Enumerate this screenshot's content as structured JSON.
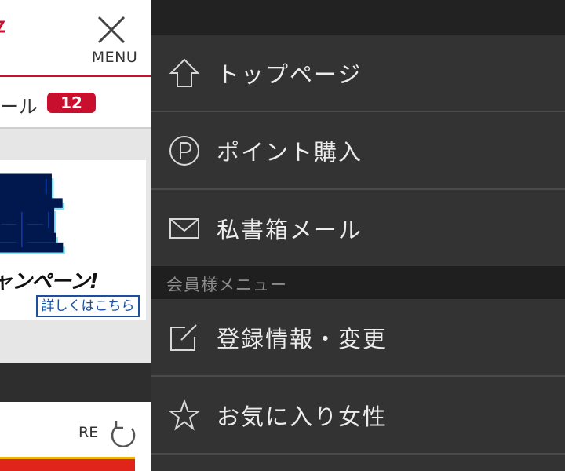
{
  "header": {
    "menu_label": "MENU"
  },
  "mail_row": {
    "label": "ール",
    "badge_count": "12"
  },
  "banner": {
    "big_char": "量",
    "subtitle": "ャンペーン!",
    "link_label": "詳しくはこちら"
  },
  "refresh": {
    "label": "RE"
  },
  "side_menu": {
    "items": [
      {
        "label": "トップページ",
        "icon": "home-icon"
      },
      {
        "label": "ポイント購入",
        "icon": "point-icon"
      },
      {
        "label": "私書箱メール",
        "icon": "mail-icon"
      }
    ],
    "section_label": "会員様メニュー",
    "member_items": [
      {
        "label": "登録情報・変更",
        "icon": "edit-icon"
      },
      {
        "label": "お気に入り女性",
        "icon": "star-icon"
      }
    ]
  },
  "colors": {
    "brand_red": "#c8102e",
    "menu_bg": "#333333",
    "menu_text": "#ececec"
  }
}
